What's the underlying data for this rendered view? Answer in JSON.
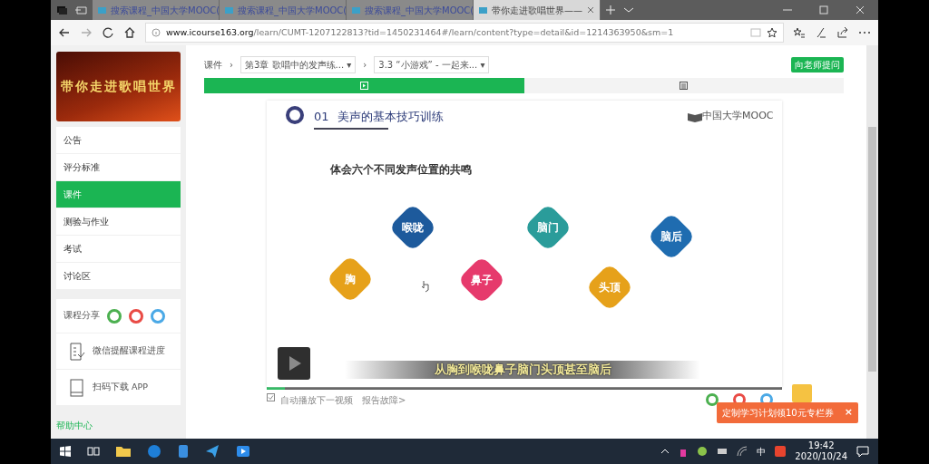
{
  "browser": {
    "tabs": [
      {
        "title": "搜索课程_中国大学MOOC(",
        "selected": false
      },
      {
        "title": "搜索课程_中国大学MOOC(",
        "selected": false
      },
      {
        "title": "搜索课程_中国大学MOOC(",
        "selected": false
      },
      {
        "title": "带你走进歌唱世界——",
        "selected": true
      }
    ],
    "url_host": "www.icourse163.org",
    "url_path": "/learn/CUMT-1207122813?tid=1450231464#/learn/content?type=detail&id=1214363950&sm=1"
  },
  "sidebar": {
    "banner_title": "带你走进歌唱世界",
    "items": [
      {
        "label": "公告",
        "selected": false
      },
      {
        "label": "评分标准",
        "selected": false
      },
      {
        "label": "课件",
        "selected": true
      },
      {
        "label": "测验与作业",
        "selected": false
      },
      {
        "label": "考试",
        "selected": false
      },
      {
        "label": "讨论区",
        "selected": false
      }
    ],
    "share_label": "课程分享",
    "wechat_reminder": "微信提醒课程进度",
    "app_download": "扫码下载 APP",
    "help": "帮助中心"
  },
  "breadcrumb": {
    "root": "课件",
    "separators": [
      "›",
      "›"
    ],
    "chapter": "第3章 歌唱中的发声练...",
    "chapter_caret": "▾",
    "lesson": "3.3 “小游戏” - 一起来...",
    "lesson_caret": "▾"
  },
  "ask_button": "向老师提问",
  "content_tabs": [
    {
      "kind": "video",
      "selected": true
    },
    {
      "kind": "document",
      "selected": false
    }
  ],
  "slide": {
    "number": "01",
    "title": "美声的基本技巧训练",
    "brand": "中国大学MOOC",
    "heading": "体会六个不同发声位置的共鸣",
    "nodes": [
      {
        "label": "喉咙",
        "color": "#1d5a9c"
      },
      {
        "label": "脑门",
        "color": "#2a9c9a"
      },
      {
        "label": "脑后",
        "color": "#1f6cb0"
      },
      {
        "label": "胸",
        "color": "#e6a11a"
      },
      {
        "label": "鼻子",
        "color": "#e63a6c"
      },
      {
        "label": "头顶",
        "color": "#e6a11a"
      }
    ],
    "subtitle": "从胸到喉咙鼻子脑门头顶甚至脑后"
  },
  "progress": {
    "level": 0.035
  },
  "autoplay": {
    "label": "自动播放下一视频",
    "checked": true
  },
  "report_link": "报告故障>",
  "promo": {
    "text": "定制学习计划领10元专栏券",
    "close": "×"
  },
  "taskbar": {
    "ime": "中",
    "time": "19:42",
    "date": "2020/10/24"
  }
}
